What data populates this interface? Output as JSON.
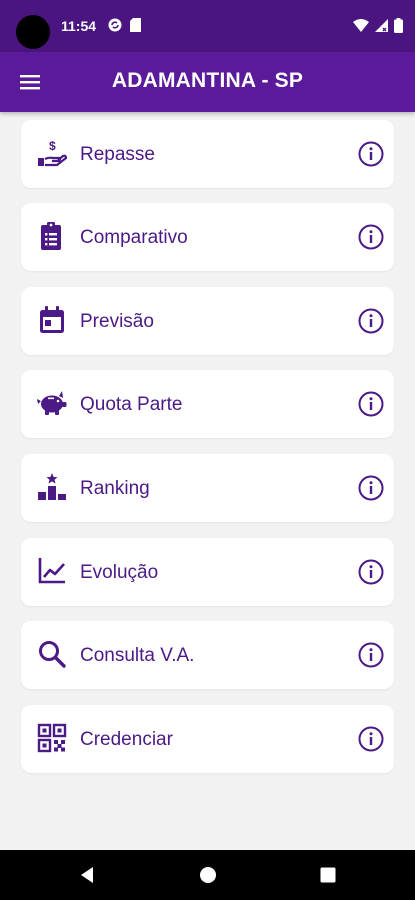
{
  "status_bar": {
    "time": "11:54",
    "left_icons": [
      "sync-icon",
      "sim-card-icon"
    ],
    "right_icons": [
      "wifi-icon",
      "signal-icon",
      "battery-icon"
    ]
  },
  "app_bar": {
    "title": "ADAMANTINA - SP",
    "menu_icon": "hamburger-menu-icon"
  },
  "colors": {
    "status_bar": "#4a1580",
    "app_bar": "#5b1a9a",
    "accent": "#4b1a86",
    "background": "#f2f2f2",
    "card": "#ffffff"
  },
  "menu": {
    "items": [
      {
        "label": "Repasse",
        "icon": "hand-coin-icon",
        "info_icon": "info-icon"
      },
      {
        "label": "Comparativo",
        "icon": "clipboard-list-icon",
        "info_icon": "info-icon"
      },
      {
        "label": "Previsão",
        "icon": "calendar-icon",
        "info_icon": "info-icon"
      },
      {
        "label": "Quota Parte",
        "icon": "piggy-bank-icon",
        "info_icon": "info-icon"
      },
      {
        "label": "Ranking",
        "icon": "podium-icon",
        "info_icon": "info-icon"
      },
      {
        "label": "Evolução",
        "icon": "line-chart-icon",
        "info_icon": "info-icon"
      },
      {
        "label": "Consulta V.A.",
        "icon": "search-icon",
        "info_icon": "info-icon"
      },
      {
        "label": "Credenciar",
        "icon": "qr-code-icon",
        "info_icon": "info-icon"
      }
    ]
  },
  "nav_bar": {
    "buttons": [
      "back-icon",
      "home-icon",
      "recents-icon"
    ]
  }
}
